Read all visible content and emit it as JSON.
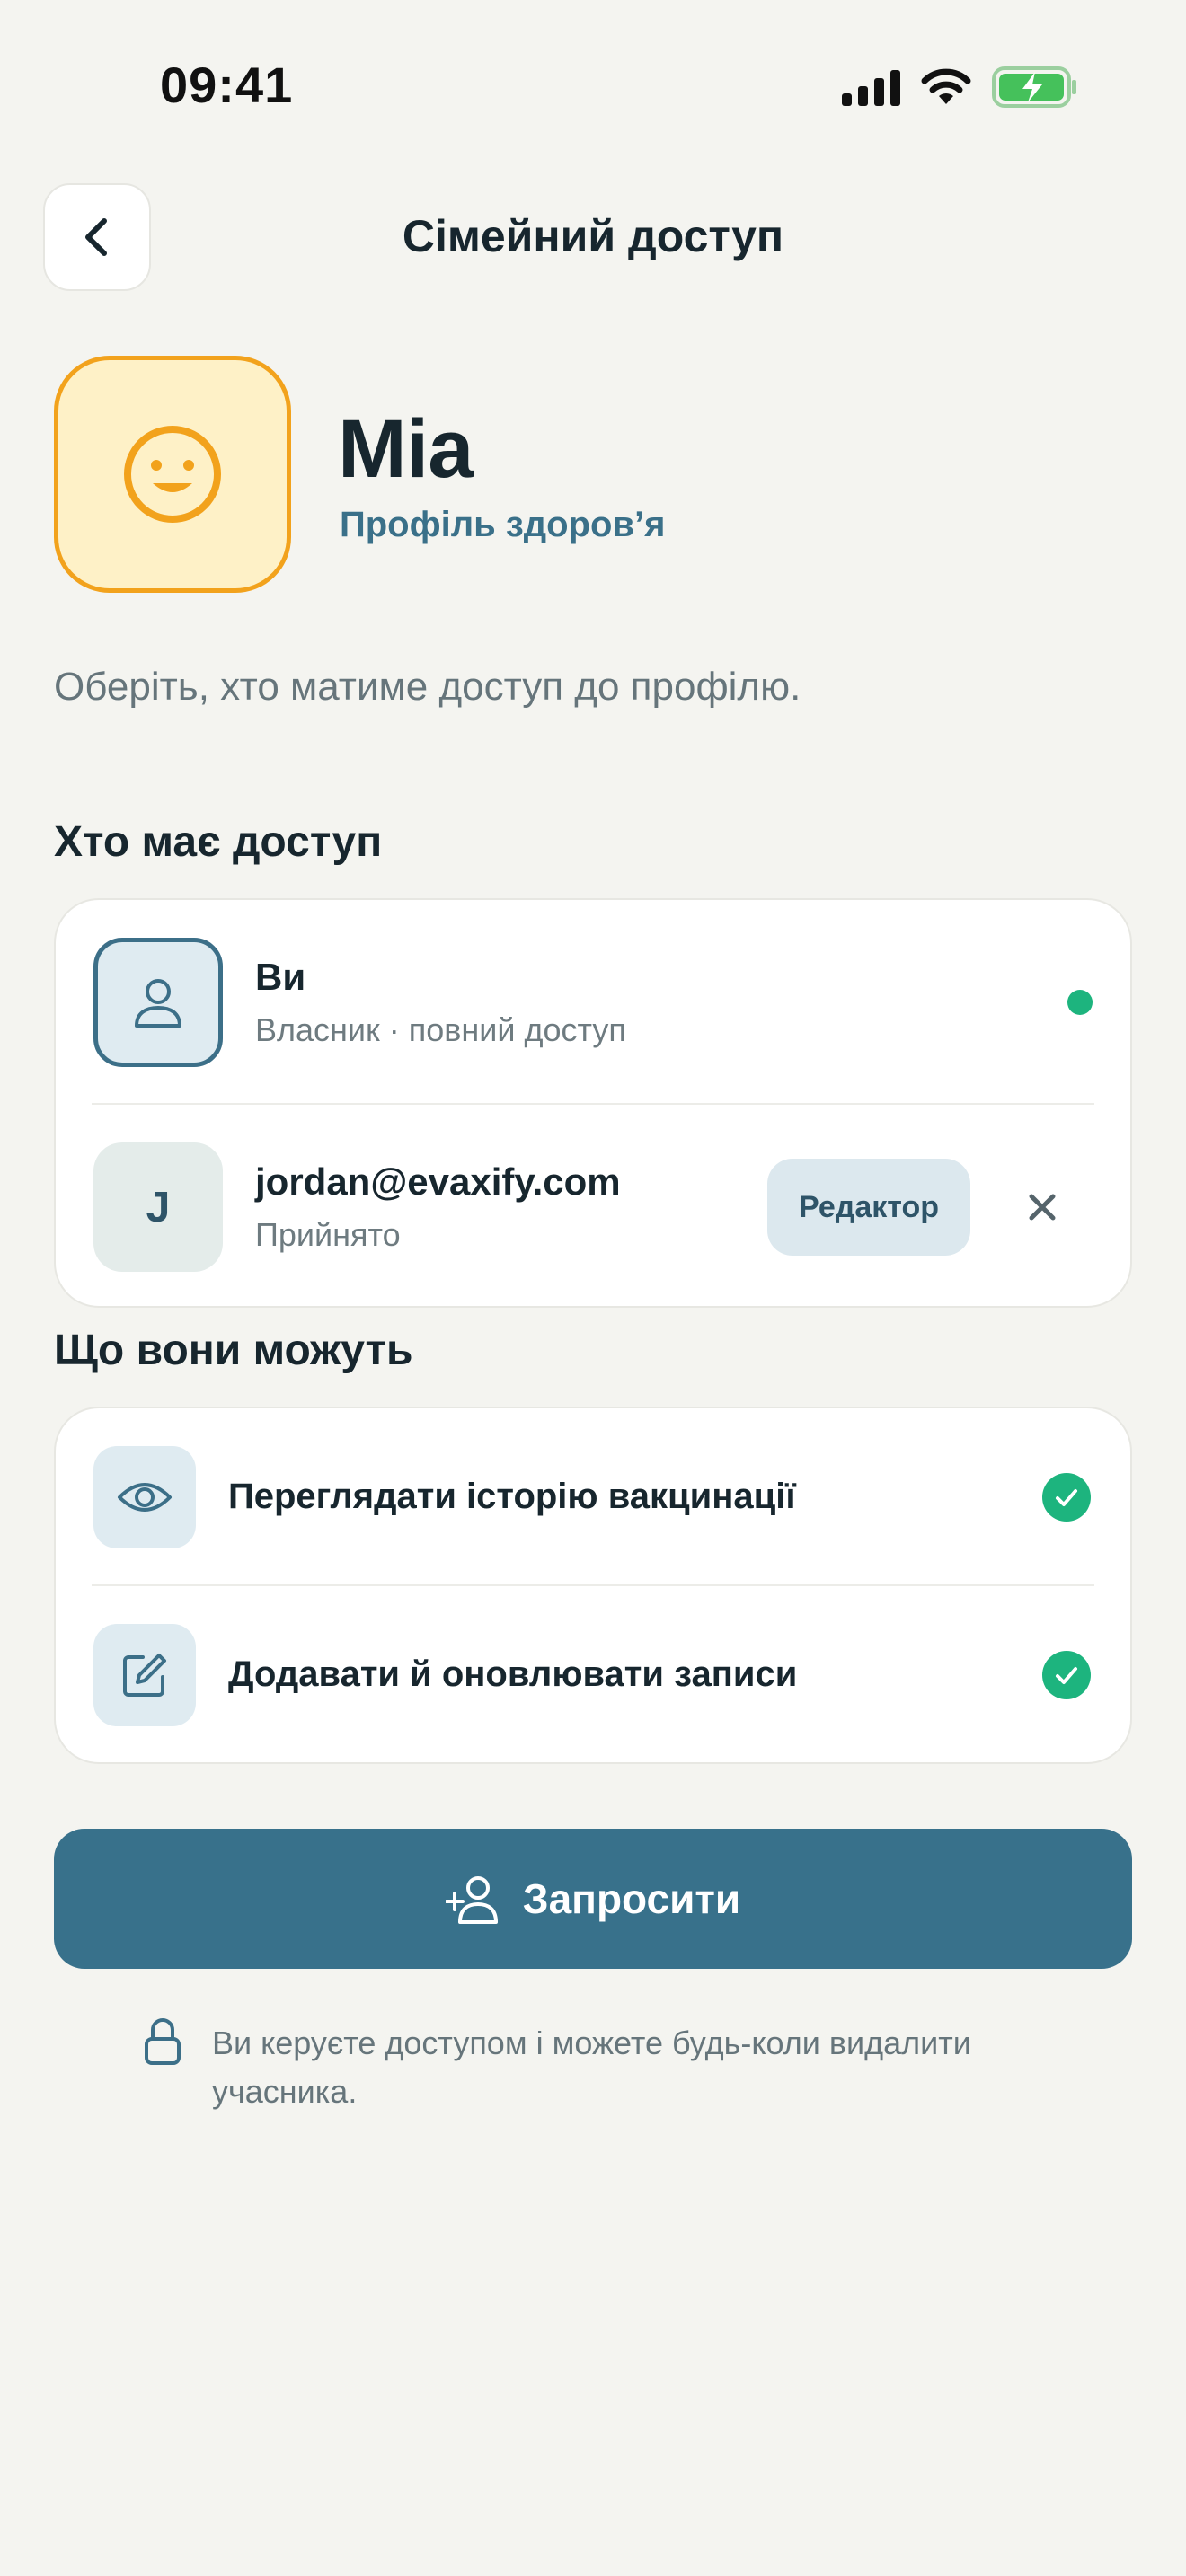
{
  "status_bar": {
    "time": "09:41"
  },
  "header": {
    "title": "Сімейний доступ"
  },
  "profile": {
    "name": "Mia",
    "subtitle": "Профіль здоров’я",
    "description": "Оберіть, хто матиме доступ до профілю."
  },
  "access_section": {
    "title": "Хто має доступ",
    "owner": {
      "name": "Ви",
      "subtitle": "Власник · повний доступ"
    },
    "member": {
      "initial": "J",
      "email": "jordan@evaxify.com",
      "status": "Прийнято",
      "role": "Редактор"
    }
  },
  "permissions_section": {
    "title": "Що вони можуть",
    "items": [
      {
        "label": "Переглядати історію вакцинації",
        "icon": "eye-icon"
      },
      {
        "label": "Додавати й оновлювати записи",
        "icon": "edit-icon"
      }
    ]
  },
  "invite_button": {
    "label": "Запросити"
  },
  "note": {
    "text": "Ви керуєте доступом і можете будь-коли видалити учасника."
  },
  "colors": {
    "accent": "#38718B",
    "success": "#1DB47E",
    "avatar_border": "#F2A21C",
    "avatar_bg": "#FEF1C7",
    "background": "#F4F4F0"
  }
}
